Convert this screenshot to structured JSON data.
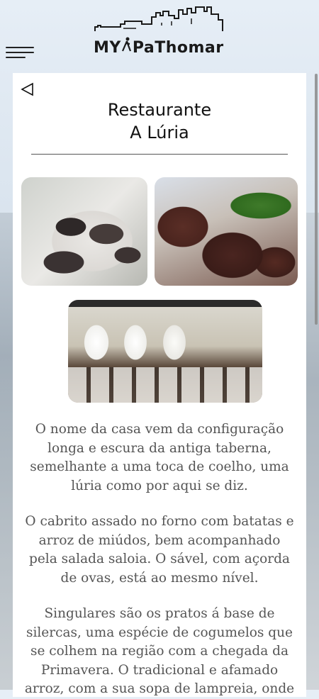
{
  "header": {
    "logo_text": "MY",
    "logo_text_2": "PaThomar",
    "menu_icon": "hamburger-icon"
  },
  "restaurant": {
    "title_line1": "Restaurante",
    "title_line2": "A Lúria",
    "back_icon": "back-triangle-icon"
  },
  "description": {
    "p1": "O nome da casa vem da configuração longa e escura da antiga taberna, semelhante a uma toca de coelho, uma lúria como por aqui se diz.",
    "p2": "O cabrito assado no forno com batatas e arroz de miúdos, bem acompanhado pela salada saloia. O sável, com açorda de ovas, está ao mesmo nível.",
    "p3": "Singulares são os pratos á base de silercas, uma espécie de cogumelos que se colhem na região com a chegada da Primavera. O tradicional e afamado arroz, com a sua sopa de lampreia, onde"
  },
  "colors": {
    "text": "#555555",
    "title": "#111111",
    "card": "#ffffff"
  }
}
